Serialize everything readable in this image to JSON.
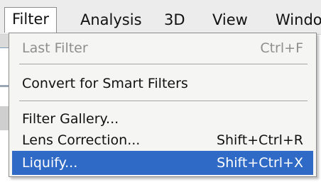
{
  "menubar": {
    "items": [
      {
        "label": "Filter"
      },
      {
        "label": "Analysis"
      },
      {
        "label": "3D"
      },
      {
        "label": "View"
      },
      {
        "label": "Windo"
      }
    ]
  },
  "filter_menu": {
    "last_filter": {
      "label": "Last Filter",
      "shortcut": "Ctrl+F",
      "enabled": false
    },
    "convert_smart": {
      "label": "Convert for Smart Filters"
    },
    "filter_gallery": {
      "label": "Filter Gallery..."
    },
    "lens_correction": {
      "label": "Lens Correction...",
      "shortcut": "Shift+Ctrl+R"
    },
    "liquify": {
      "label": "Liquify...",
      "shortcut": "Shift+Ctrl+X",
      "highlighted": true
    }
  },
  "colors": {
    "highlight": "#2f6ac6",
    "disabled_text": "#8e8e8e",
    "menu_background": "#f5f5f3"
  }
}
